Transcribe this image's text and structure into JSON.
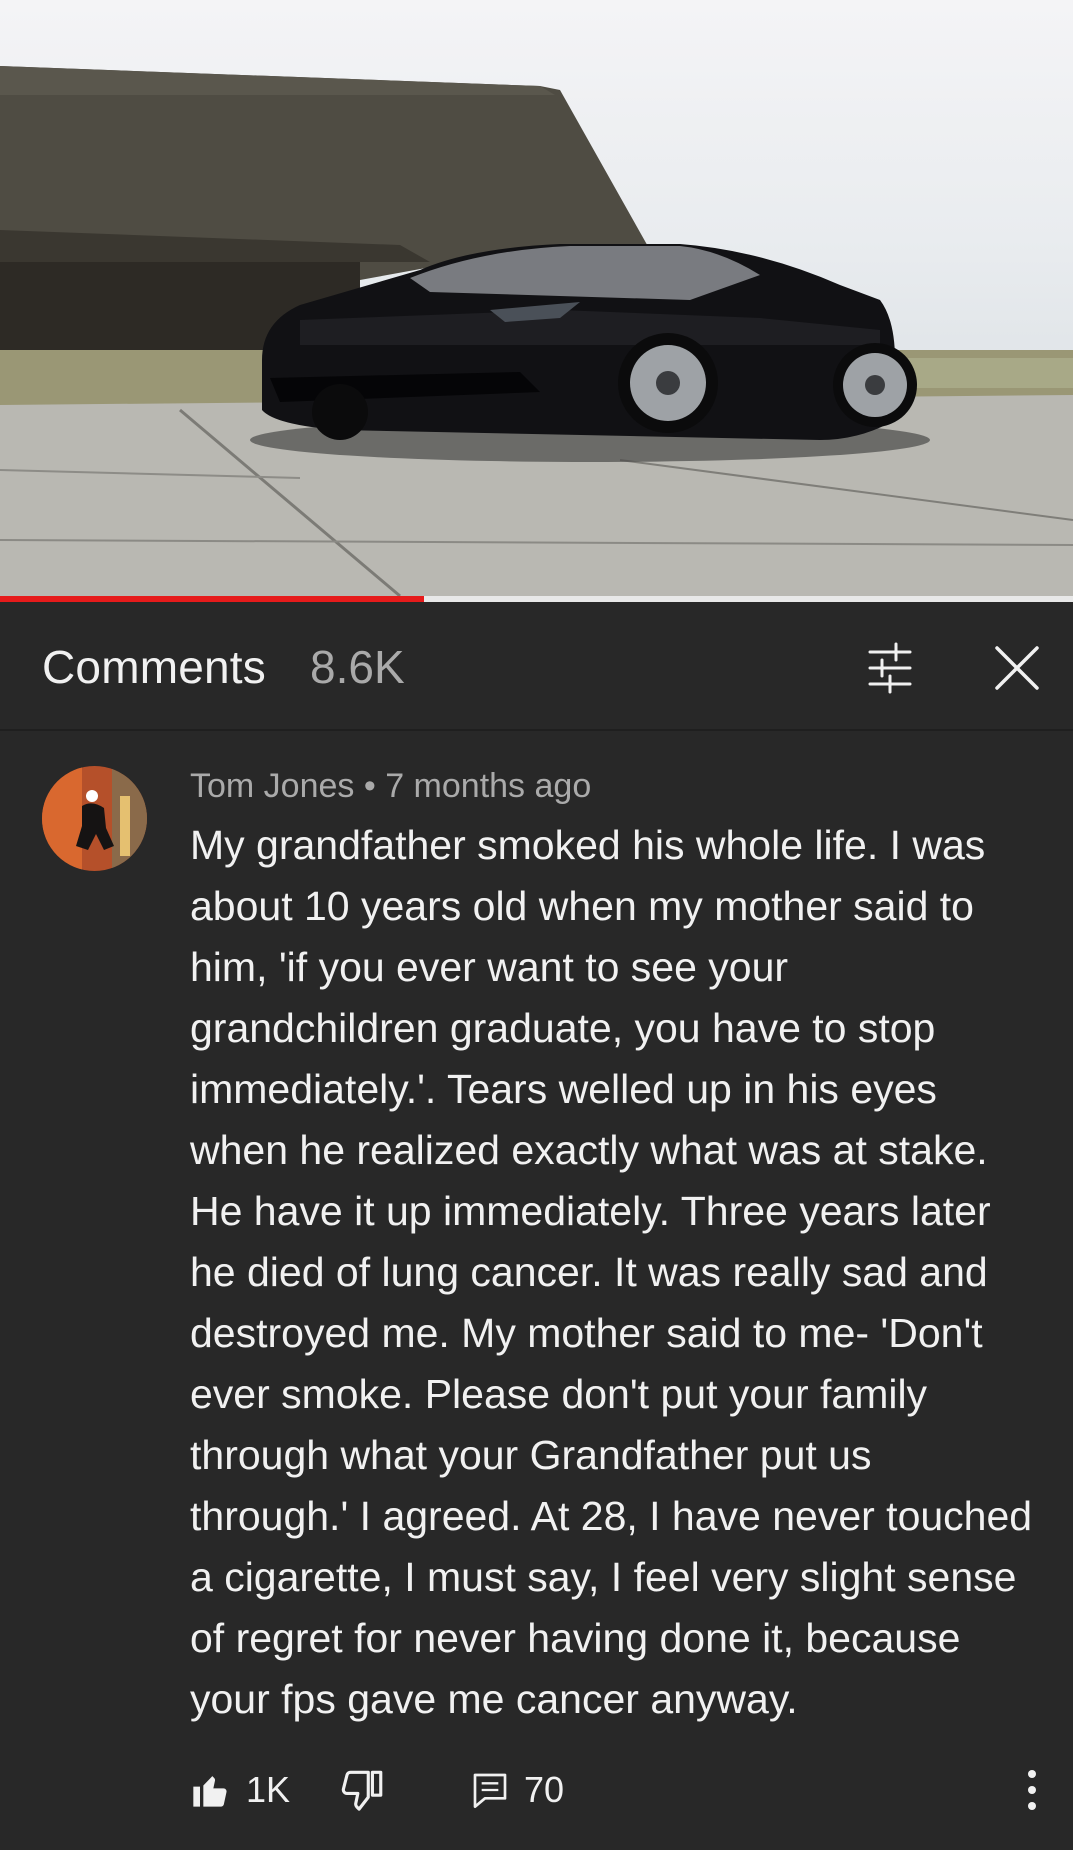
{
  "video": {
    "thumbnail_icon": "video-frame-car",
    "progress_fraction": 0.395
  },
  "comments_panel": {
    "title": "Comments",
    "count": "8.6K",
    "filter_icon": "sliders-icon",
    "close_icon": "close-icon"
  },
  "comment": {
    "author": "Tom Jones",
    "separator": " • ",
    "time": "7 months ago",
    "body": "My grandfather smoked his whole life. I was about 10 years old when my mother said to him, 'if you ever want to see your grandchildren graduate, you have to stop immediately.'. Tears welled up in his eyes when he realized exactly what was at stake. He have it up immediately. Three years later he died of lung cancer. It was really sad and destroyed me. My mother said to me- 'Don't ever smoke. Please don't put your family through what your Grandfather put us through.' I agreed. At 28, I have never touched a cigarette, I must say, I feel very slight sense of regret for never having done it, because your fps gave me cancer anyway.",
    "likes": "1K",
    "replies": "70"
  },
  "colors": {
    "background": "#282828",
    "progress": "#e61b1b",
    "text_primary": "#f1f1f1",
    "text_secondary": "#aaaaaa"
  }
}
